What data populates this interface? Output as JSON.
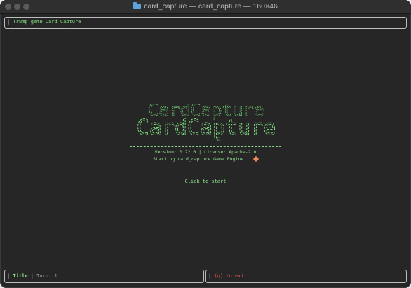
{
  "window": {
    "title": "card_capture — card_capture — 160×46"
  },
  "header": {
    "text": "Trump game Card Capture"
  },
  "splash": {
    "logo_text": "CardCapture",
    "version_line": "Version: 0.22.0  |  License: Apache-2.0",
    "starting_line": "Starting card_capture Game Engine...",
    "start_button": "Click to start"
  },
  "footer": {
    "title_label": "Title",
    "turn_label": "Turn: 1",
    "exit_label": "(q) to exit"
  },
  "colors": {
    "background": "#262626",
    "accent_green": "#8fe08f",
    "exit_red": "#e2584f"
  }
}
